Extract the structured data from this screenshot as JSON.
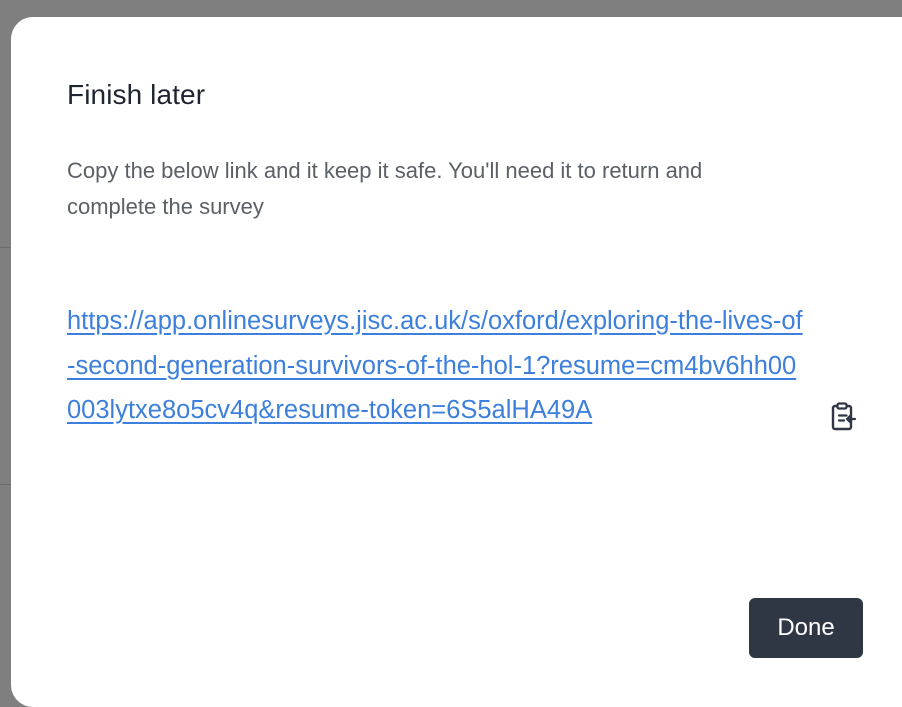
{
  "dialog": {
    "title": "Finish later",
    "description": "Copy the below link and it keep it safe. You'll need it to return and complete the survey",
    "resume_link": "https://app.onlinesurveys.jisc.ac.uk/s/oxford/exploring-the-lives-of-second-generation-survivors-of-the-hol-1?resume=cm4bv6hh00003lytxe8o5cv4q&resume-token=6S5alHA49A",
    "copy_icon": "clipboard-copy-icon",
    "done_label": "Done"
  },
  "colors": {
    "overlay": "#7f7f7f",
    "dialog_bg": "#ffffff",
    "title": "#1f2530",
    "text_secondary": "#5b5f66",
    "link": "#3d7fdc",
    "button_bg": "#2f3644",
    "button_text": "#ffffff"
  }
}
